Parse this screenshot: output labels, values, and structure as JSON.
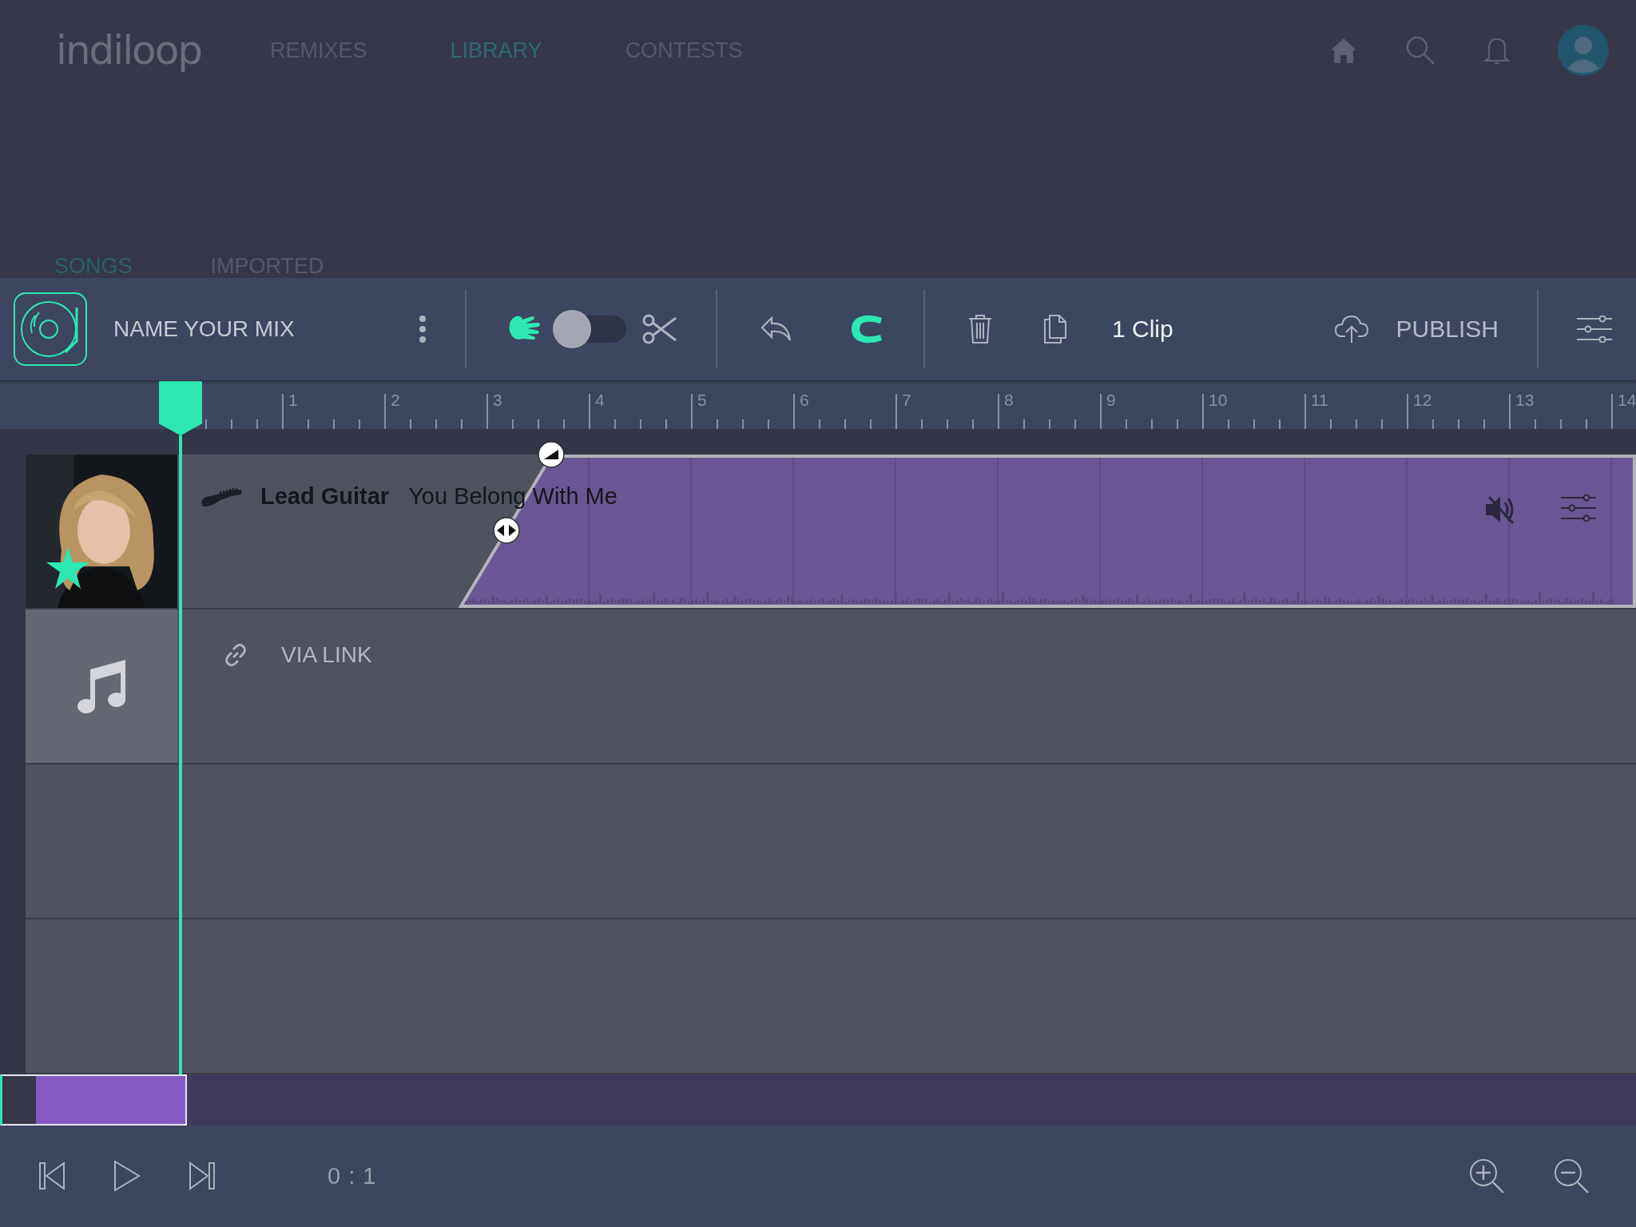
{
  "nav": {
    "logo": "indiloop",
    "items": [
      {
        "label": "REMIXES",
        "selected": false
      },
      {
        "label": "LIBRARY",
        "selected": true
      },
      {
        "label": "CONTESTS",
        "selected": false
      }
    ]
  },
  "subtabs": [
    {
      "label": "SONGS",
      "selected": true
    },
    {
      "label": "IMPORTED",
      "selected": false
    }
  ],
  "toolbar": {
    "mix_name": "NAME YOUR MIX",
    "mode_toggle": {
      "on": false
    },
    "snap": {
      "on": true
    },
    "clip_count": "1 Clip",
    "publish": "PUBLISH"
  },
  "ruler": {
    "labels": [
      "1",
      "2",
      "3",
      "4",
      "5",
      "6",
      "7",
      "8",
      "9",
      "10",
      "11",
      "12",
      "13",
      "14"
    ]
  },
  "tracks": [
    {
      "kind": "clip",
      "instrument": "Lead Guitar",
      "song": "You Belong With Me",
      "starred": true,
      "muted": true
    },
    {
      "kind": "link",
      "label": "VIA LINK"
    },
    {
      "kind": "empty"
    },
    {
      "kind": "empty"
    }
  ],
  "transport": {
    "time": "0 : 1"
  }
}
